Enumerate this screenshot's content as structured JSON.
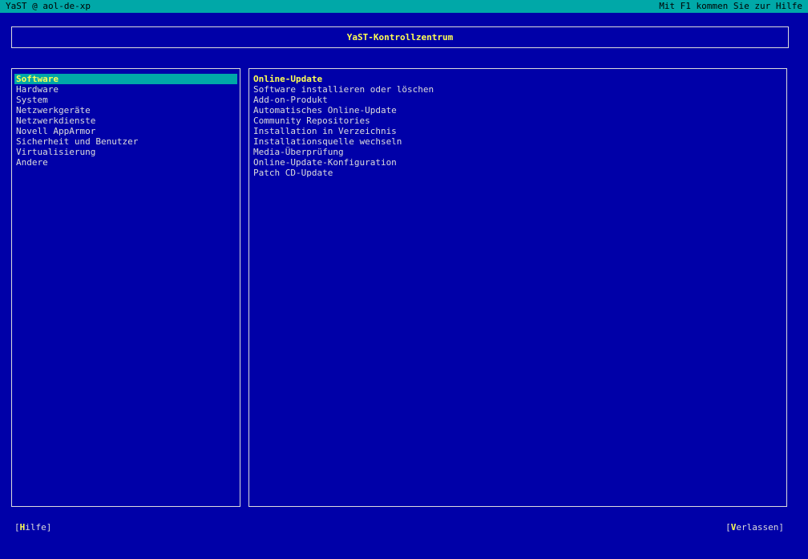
{
  "topbar": {
    "left": "YaST @ aol-de-xp",
    "right": "Mit F1 kommen Sie zur Hilfe"
  },
  "title": "YaST-Kontrollzentrum",
  "categories": {
    "selected": "Software",
    "items": [
      "Software",
      "Hardware",
      "System",
      "Netzwerkgeräte",
      "Netzwerkdienste",
      "Novell AppArmor",
      "Sicherheit und Benutzer",
      "Virtualisierung",
      "Andere"
    ]
  },
  "modules": {
    "selected": "Online-Update",
    "items": [
      "Online-Update",
      "Software installieren oder löschen",
      "Add-on-Produkt",
      "Automatisches Online-Update",
      "Community Repositories",
      "Installation in Verzeichnis",
      "Installationsquelle wechseln",
      "Media-Überprüfung",
      "Online-Update-Konfiguration",
      "Patch CD-Update"
    ]
  },
  "footer": {
    "help": {
      "prefix": "[",
      "hotkey": "H",
      "suffix": "ilfe]"
    },
    "quit": {
      "prefix": "[",
      "hotkey": "V",
      "suffix": "erlassen]"
    }
  },
  "colors": {
    "bg": "#0000a8",
    "bar": "#00a8a8",
    "text": "#dcdcdc",
    "border": "#dcdcdc",
    "selected_bg": "#00a8a8",
    "highlight": "#ffff54",
    "topbar_text": "#000000"
  }
}
